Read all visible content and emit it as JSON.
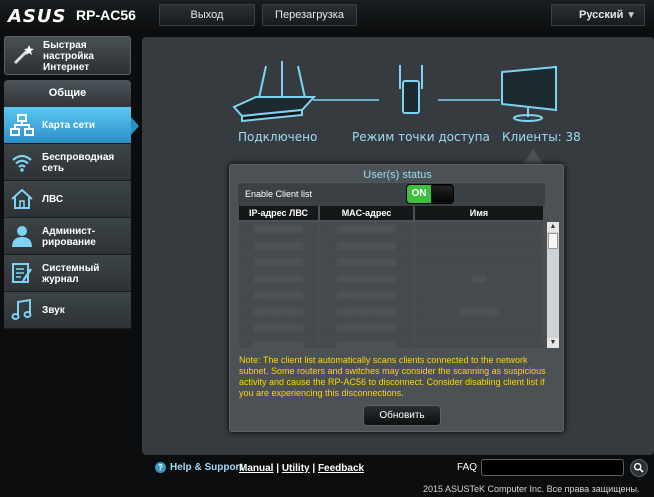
{
  "header": {
    "brand": "ASUS",
    "model": "RP-AC56",
    "logout_label": "Выход",
    "reboot_label": "Перезагрузка",
    "language": "Русский"
  },
  "sidebar": {
    "quick_setup_label": "Быстрая настройка Интернет",
    "section_title": "Общие",
    "items": [
      {
        "label": "Карта сети",
        "icon": "network-map-icon",
        "active": true
      },
      {
        "label": "Беспроводная сеть",
        "icon": "wifi-icon",
        "active": false
      },
      {
        "label": "ЛВС",
        "icon": "home-icon",
        "active": false
      },
      {
        "label": "Админист­рирование",
        "icon": "admin-user-icon",
        "active": false
      },
      {
        "label": "Системный журнал",
        "icon": "log-icon",
        "active": false
      },
      {
        "label": "Звук",
        "icon": "music-icon",
        "active": false
      }
    ]
  },
  "map": {
    "status_connected": "Подключено",
    "mode_label": "Режим точки доступа",
    "clients_label": "Клиенты: 38"
  },
  "user_status": {
    "title": "User(s) status",
    "enable_label": "Enable Client list",
    "toggle_state": "ON",
    "columns": [
      "IP-адрес ЛВС",
      "MAC-адрес",
      "Имя"
    ],
    "note": "Note: The client list automatically scans clients connected to the network subnet. Some routers and switches may consider the scanning as suspicious activity and cause the RP-AC56 to disconnect. Consider disabling client list if you are experiencing this disconnections.",
    "refresh_label": "Обновить"
  },
  "footer": {
    "help_label": "Help & Support",
    "manual": "Manual",
    "utility": "Utility",
    "feedback": "Feedback",
    "faq_label": "FAQ",
    "copyright": "2015 ASUSTeK Computer Inc. Все права защищены."
  },
  "colors": {
    "accent": "#9fdcf2",
    "active_menu": "#2c8ec6",
    "toggle_on": "#3fbf3f",
    "note_text": "#ffd800"
  }
}
